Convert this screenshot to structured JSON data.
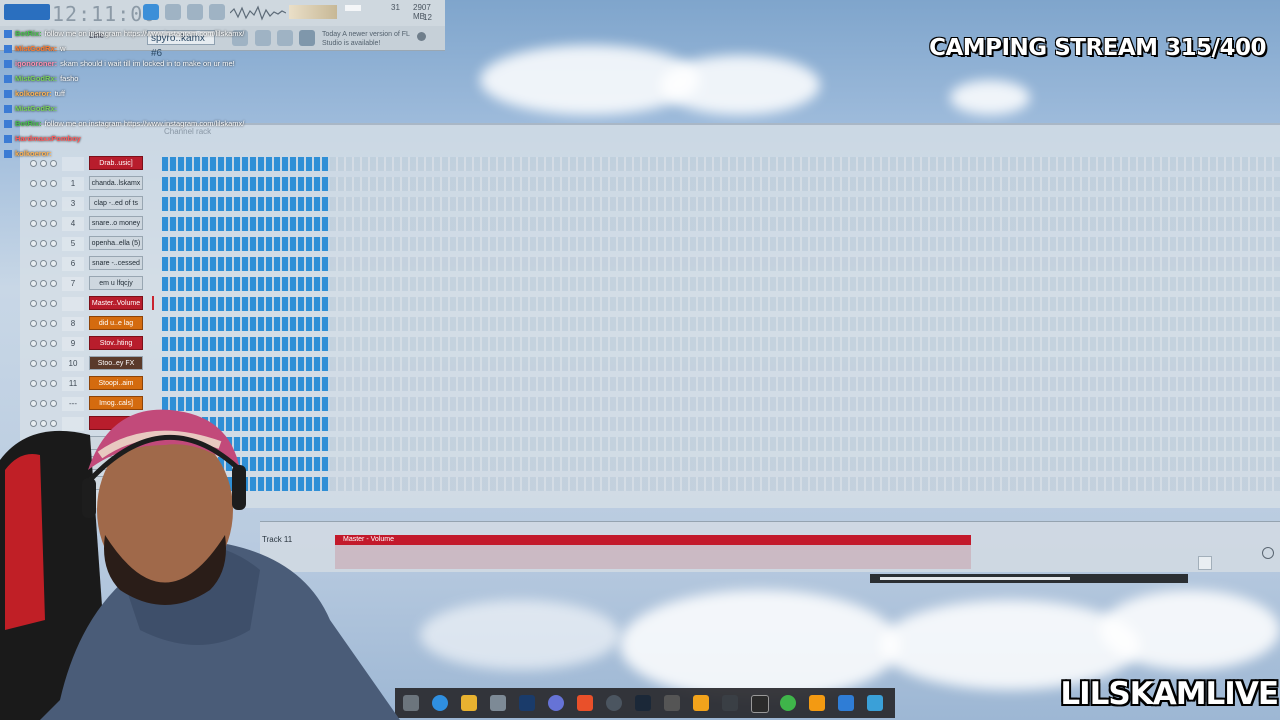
{
  "toolbar": {
    "time": "12:11:00",
    "cpu_text": "31",
    "memory_text": "2907 MB",
    "polyphony": "12"
  },
  "toolbar2": {
    "snap_label": "Line",
    "pattern_label": "spyro..kamx #6",
    "news_text": "Today  A newer version of FL Studio is available!"
  },
  "overlay": {
    "stream_title": "CAMPING STREAM 315/400",
    "channel_name": "LILSKAMLIVE"
  },
  "chat": [
    {
      "user": "BotRix:",
      "text": "follow me on instagram https://www.instagram.com/lilskamx/"
    },
    {
      "user": "MistGodRx:",
      "text": "w"
    },
    {
      "user": "igonoroner:",
      "text": "skam should i wait till im locked in to make on ur me!"
    },
    {
      "user": "MistGodRx:",
      "text": "fasho"
    },
    {
      "user": "kolkoeror:",
      "text": "tuff"
    },
    {
      "user": "MistGodRx:",
      "text": ""
    },
    {
      "user": "BotRix:",
      "text": "follow me on instagram https://www.instagram.com/lilskamx/"
    },
    {
      "user": "HardmaxxPomboy",
      "text": ""
    },
    {
      "user": "kolkoeror:",
      "text": ""
    }
  ],
  "rack": {
    "title": "Channel rack",
    "channels": [
      {
        "num": "",
        "name": "Drab..usic]",
        "color": "red"
      },
      {
        "num": "1",
        "name": "chanda..lskamx",
        "color": "gray"
      },
      {
        "num": "3",
        "name": "clap -..ed of ts",
        "color": "gray"
      },
      {
        "num": "4",
        "name": "snare..o money",
        "color": "gray"
      },
      {
        "num": "5",
        "name": "openha..ella (5)",
        "color": "gray"
      },
      {
        "num": "6",
        "name": "snare -..cessed",
        "color": "gray"
      },
      {
        "num": "7",
        "name": "em u lfqcjy",
        "color": "gray"
      },
      {
        "num": "",
        "name": "Master..Volume",
        "color": "red"
      },
      {
        "num": "8",
        "name": "did u..e lag",
        "color": "orange"
      },
      {
        "num": "9",
        "name": "Stov..hting",
        "color": "red"
      },
      {
        "num": "10",
        "name": "Stoo..ey FX",
        "color": "dark"
      },
      {
        "num": "11",
        "name": "Stoopi..aim",
        "color": "orange"
      },
      {
        "num": "---",
        "name": "Imog..cals]",
        "color": "orange"
      },
      {
        "num": "",
        "name": "",
        "color": "red"
      },
      {
        "num": "",
        "name": "",
        "color": "gray"
      },
      {
        "num": "",
        "name": "",
        "color": "gray"
      },
      {
        "num": "",
        "name": "",
        "color": "gray"
      }
    ]
  },
  "playlist": {
    "track_label": "Track 11",
    "clip_label": "Master - Volume"
  },
  "colors": {
    "step_on": "#2f8fd6",
    "channel_red": "#b81d2c",
    "channel_orange": "#d46b0f",
    "clip_red": "#c3192b"
  }
}
